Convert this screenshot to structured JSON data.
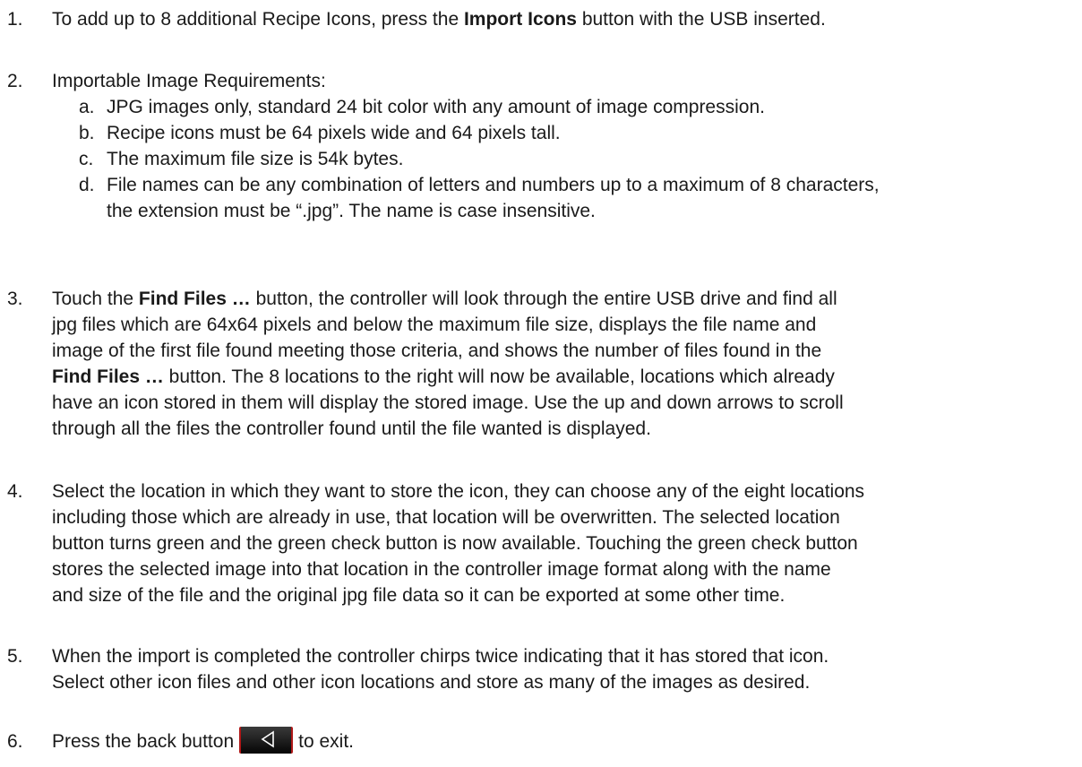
{
  "items": [
    {
      "num": "1.",
      "parts": [
        "To add up to 8 additional Recipe Icons, press the ",
        "Import Icons",
        " button with the USB inserted."
      ]
    },
    {
      "num": "2.",
      "lead": "Importable Image Requirements:",
      "subitems": [
        {
          "letter": "a.",
          "text": "JPG images only, standard 24 bit color with any amount of image compression."
        },
        {
          "letter": "b.",
          "text": "Recipe icons must be 64 pixels wide and 64 pixels tall."
        },
        {
          "letter": "c.",
          "text": "The maximum file size is 54k bytes."
        },
        {
          "letter": "d.",
          "line1": "File names can be any combination of letters and numbers up to a maximum of 8 characters,",
          "line2": "the extension must be “.jpg”. The name is case insensitive."
        }
      ]
    },
    {
      "num": "3.",
      "l1a": "Touch the ",
      "l1b": "Find Files …",
      "l1c": " button, the controller will look through the entire USB drive and find all",
      "l2": "jpg files which are 64x64 pixels and below the maximum file size, displays the file name and",
      "l3": "image of the first file found meeting those criteria, and shows the number of files found in the",
      "l4a": "Find Files …",
      "l4b": " button. The 8 locations to the right will now be available, locations which already",
      "l5": "have an icon stored in them will display the stored image. Use the up and down arrows to scroll",
      "l6": "through all the files the controller found until the file wanted is displayed."
    },
    {
      "num": "4.",
      "lines": [
        "Select the location in which they want to store the icon, they can choose any of the eight locations",
        "including those which are already in use, that location will be overwritten.  The selected location",
        "button turns green and the green check button is now available. Touching the green check button",
        "stores the selected image into that location in the controller image format along with the name",
        "and size of the file and the original jpg file data so it can be exported at some other time."
      ]
    },
    {
      "num": "5.",
      "lines": [
        "When the import is completed the controller chirps twice indicating that it has stored that icon.",
        "Select other icon files and other icon locations and store as many of the images as desired."
      ]
    },
    {
      "num": "6.",
      "before": "Press the back button",
      "after": "to exit.",
      "back_icon": "back-triangle-icon"
    }
  ]
}
